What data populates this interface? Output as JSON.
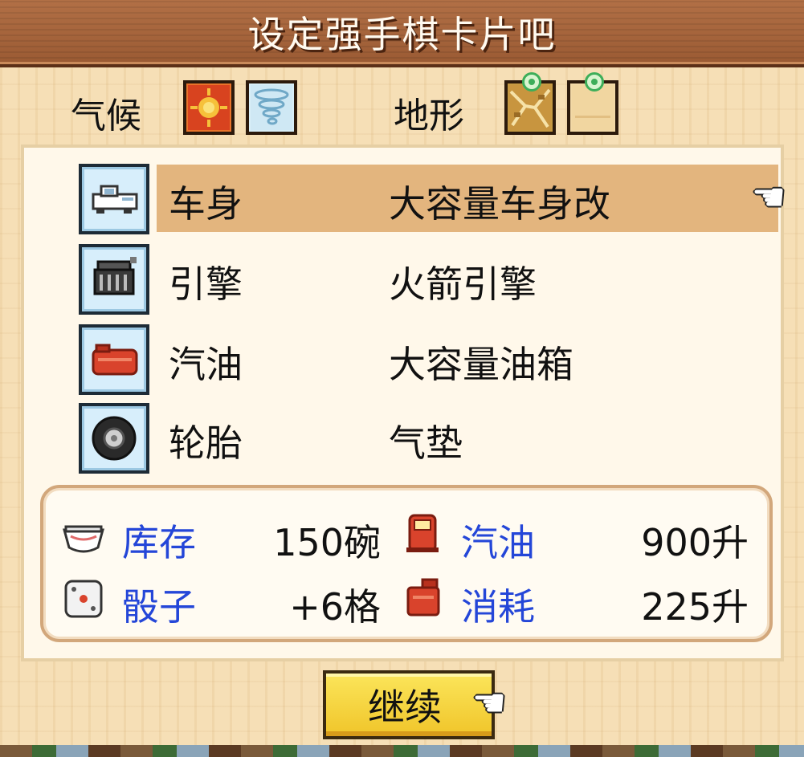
{
  "title": "设定强手棋卡片吧",
  "conditions": {
    "climate": {
      "label": "气候",
      "tiles": [
        {
          "icon": "sun-icon",
          "color": "#e9732a"
        },
        {
          "icon": "tornado-icon",
          "color": "#d8eef7"
        }
      ]
    },
    "terrain": {
      "label": "地形",
      "tiles": [
        {
          "icon": "rocky-terrain-icon",
          "color": "#c69a42"
        },
        {
          "icon": "flat-terrain-icon",
          "color": "#f3d9a6"
        }
      ]
    }
  },
  "parts": [
    {
      "icon": "car-body-icon",
      "name": "车身",
      "value": "大容量车身改",
      "selected": true
    },
    {
      "icon": "engine-icon",
      "name": "引擎",
      "value": "火箭引擎",
      "selected": false
    },
    {
      "icon": "gas-tank-icon",
      "name": "汽油",
      "value": "大容量油箱",
      "selected": false
    },
    {
      "icon": "tire-icon",
      "name": "轮胎",
      "value": "气垫",
      "selected": false
    }
  ],
  "stats": [
    {
      "icon": "bowl-icon",
      "label": "库存",
      "value": "150碗"
    },
    {
      "icon": "fuel-pump-icon",
      "label": "汽油",
      "value": "900升"
    },
    {
      "icon": "dice-icon",
      "label": "骰子",
      "value": "+6格"
    },
    {
      "icon": "fuel-can-icon",
      "label": "消耗",
      "value": "225升"
    }
  ],
  "continue_label": "继续",
  "colors": {
    "title_bar": "#a8633a",
    "selection": "#e3b57e",
    "stat_label": "#2446d8",
    "button": "#f6d63c"
  }
}
